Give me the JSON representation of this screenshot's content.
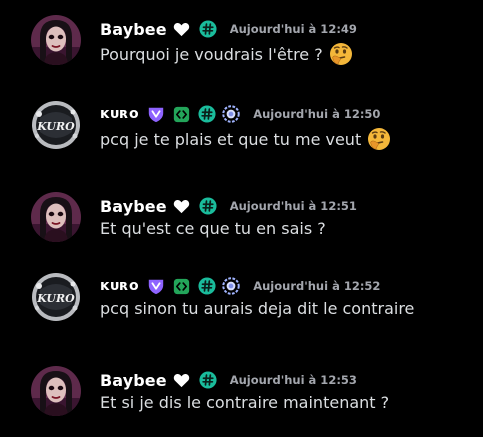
{
  "messages": [
    {
      "author": "Baybee",
      "avatar": "baybee-avatar",
      "badges": [
        "heart-icon",
        "hashtag-badge-icon"
      ],
      "timestamp": "Aujourd'hui à 12:49",
      "text": "Pourquoi je voudrais l'être ?",
      "emoji": "thinking-face-emoji"
    },
    {
      "author": "ĸᴜʀᴏ",
      "avatar": "kuro-avatar",
      "badges": [
        "purple-shield-icon",
        "green-code-badge-icon",
        "hashtag-badge-icon",
        "laurel-badge-icon"
      ],
      "timestamp": "Aujourd'hui à 12:50",
      "text": "pcq je te plais et que tu me veut",
      "emoji": "thinking-face-emoji"
    },
    {
      "author": "Baybee",
      "avatar": "baybee-avatar",
      "badges": [
        "heart-icon",
        "hashtag-badge-icon"
      ],
      "timestamp": "Aujourd'hui à 12:51",
      "text": "Et qu'est ce que tu en sais ?",
      "emoji": ""
    },
    {
      "author": "ĸᴜʀᴏ",
      "avatar": "kuro-avatar",
      "badges": [
        "purple-shield-icon",
        "green-code-badge-icon",
        "hashtag-badge-icon",
        "laurel-badge-icon"
      ],
      "timestamp": "Aujourd'hui à 12:52",
      "text": "pcq sinon tu aurais deja dit le contraire",
      "emoji": ""
    },
    {
      "author": "Baybee",
      "avatar": "baybee-avatar",
      "badges": [
        "heart-icon",
        "hashtag-badge-icon"
      ],
      "timestamp": "Aujourd'hui à 12:53",
      "text": "Et si je dis le contraire maintenant ?",
      "emoji": ""
    }
  ],
  "kuro_avatar_logo": "KURO",
  "colors": {
    "background": "#000000",
    "username": "#ffffff",
    "timestamp": "#a3a6ad",
    "message_text": "#dbdee1",
    "badge_green": "#23a55a",
    "badge_teal": "#1abc9c",
    "badge_purple": "#8e63ff",
    "laurel_blue": "#a0b4ff"
  }
}
